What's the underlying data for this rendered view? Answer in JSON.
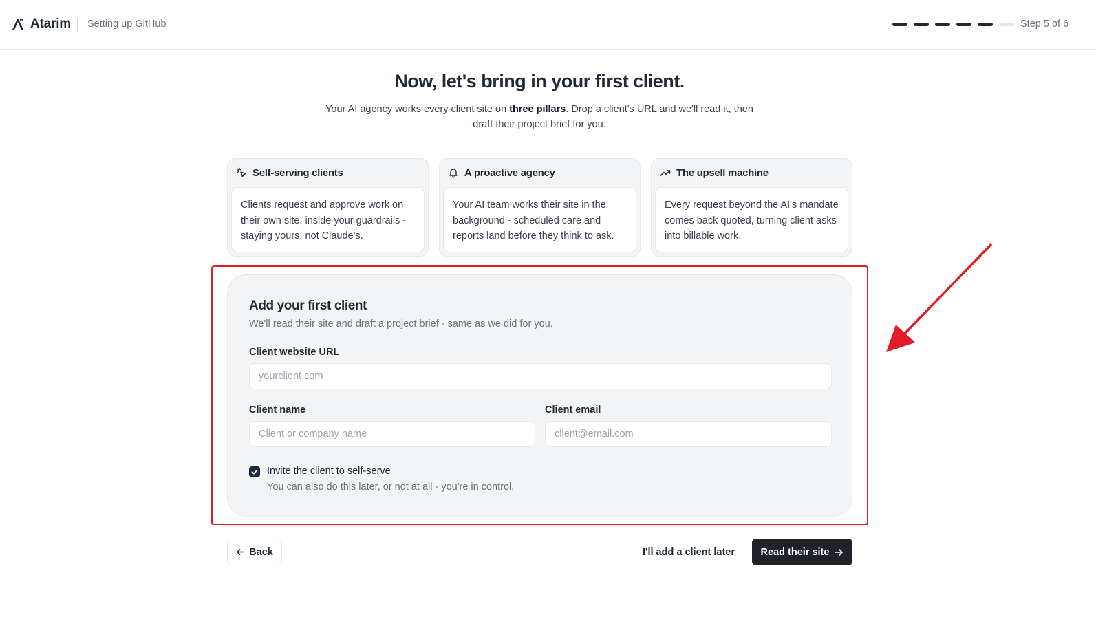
{
  "header": {
    "brand": "Atarim",
    "context": "Setting up GitHub",
    "progress": {
      "current": 5,
      "total": 6
    },
    "step_label": "Step 5 of 6"
  },
  "intro": {
    "title": "Now, let's bring in your first client.",
    "subtitle_before": "Your AI agency works every client site on ",
    "subtitle_bold": "three pillars",
    "subtitle_after": ". Drop a client's URL and we'll read it, then draft their project brief for you."
  },
  "pillars": [
    {
      "icon": "sparkle-cursor-icon",
      "title": "Self-serving clients",
      "body": "Clients request and approve work on their own site, inside your guardrails - staying yours, not Claude's."
    },
    {
      "icon": "bell-icon",
      "title": "A proactive agency",
      "body": "Your AI team works their site in the background - scheduled care and reports land before they think to ask."
    },
    {
      "icon": "trending-up-icon",
      "title": "The upsell machine",
      "body": "Every request beyond the AI's mandate comes back quoted, turning client asks into billable work."
    }
  ],
  "form": {
    "title": "Add your first client",
    "subtitle": "We'll read their site and draft a project brief - same as we did for you.",
    "url_label": "Client website URL",
    "url_placeholder": "yourclient.com",
    "url_value": "",
    "name_label": "Client name",
    "name_placeholder": "Client or company name",
    "name_value": "",
    "email_label": "Client email",
    "email_placeholder": "client@email.com",
    "email_value": "",
    "invite_checked": true,
    "invite_label": "Invite the client to self-serve",
    "invite_help": "You can also do this later, or not at all - you're in control."
  },
  "actions": {
    "back": "Back",
    "later": "I'll add a client later",
    "primary": "Read their site"
  },
  "colors": {
    "accent_dark": "#1f2329",
    "highlight": "#e11d28",
    "annotation_arrow": "#e11d28"
  }
}
